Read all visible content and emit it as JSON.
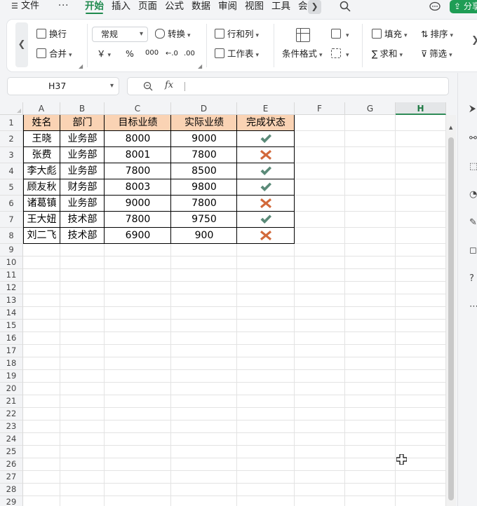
{
  "menubar": {
    "file_label": "文件",
    "more_label": "···",
    "tabs": [
      "开始",
      "插入",
      "页面",
      "公式",
      "数据",
      "审阅",
      "视图",
      "工具",
      "会"
    ],
    "share_label": "分享"
  },
  "ribbon": {
    "wrap": "换行",
    "merge": "合并",
    "number_format": "常规",
    "convert": "转换",
    "rows_cols": "行和列",
    "worksheet": "工作表",
    "conditional_format": "条件格式",
    "fill": "填充",
    "sort": "排序",
    "sum": "求和",
    "filter": "筛选",
    "currency_symbol": "￥",
    "percent_symbol": "%",
    "thousands_symbol": "000"
  },
  "formula_bar": {
    "cell_ref": "H37",
    "fx_label": "fx",
    "content": ""
  },
  "columns": [
    "A",
    "B",
    "C",
    "D",
    "E",
    "F",
    "G",
    "H"
  ],
  "selected_column": "H",
  "row_numbers": [
    "1",
    "2",
    "3",
    "4",
    "5",
    "6",
    "7",
    "8",
    "9",
    "10",
    "11",
    "12",
    "13",
    "14",
    "15",
    "16",
    "17",
    "18",
    "19",
    "20",
    "21",
    "22",
    "23",
    "24",
    "25",
    "26",
    "27",
    "28",
    "29"
  ],
  "table": {
    "headers": [
      "姓名",
      "部门",
      "目标业绩",
      "实际业绩",
      "完成状态"
    ],
    "header_fill": "#fad3b4",
    "rows": [
      {
        "name": "王晓",
        "dept": "业务部",
        "target": "8000",
        "actual": "9000",
        "status": "check"
      },
      {
        "name": "张费",
        "dept": "业务部",
        "target": "8001",
        "actual": "7800",
        "status": "cross"
      },
      {
        "name": "李大彪",
        "dept": "业务部",
        "target": "7800",
        "actual": "8500",
        "status": "check"
      },
      {
        "name": "顾友秋",
        "dept": "财务部",
        "target": "8003",
        "actual": "9800",
        "status": "check"
      },
      {
        "name": "诸葛镇",
        "dept": "业务部",
        "target": "9000",
        "actual": "7800",
        "status": "cross"
      },
      {
        "name": "王大妞",
        "dept": "技术部",
        "target": "7800",
        "actual": "9750",
        "status": "check"
      },
      {
        "name": "刘二飞",
        "dept": "技术部",
        "target": "6900",
        "actual": "900",
        "status": "cross"
      }
    ],
    "check_color": "#5a8a78",
    "cross_color": "#d2693a"
  },
  "colors": {
    "accent": "#1f8a4e",
    "share_button": "#1f9d55"
  }
}
